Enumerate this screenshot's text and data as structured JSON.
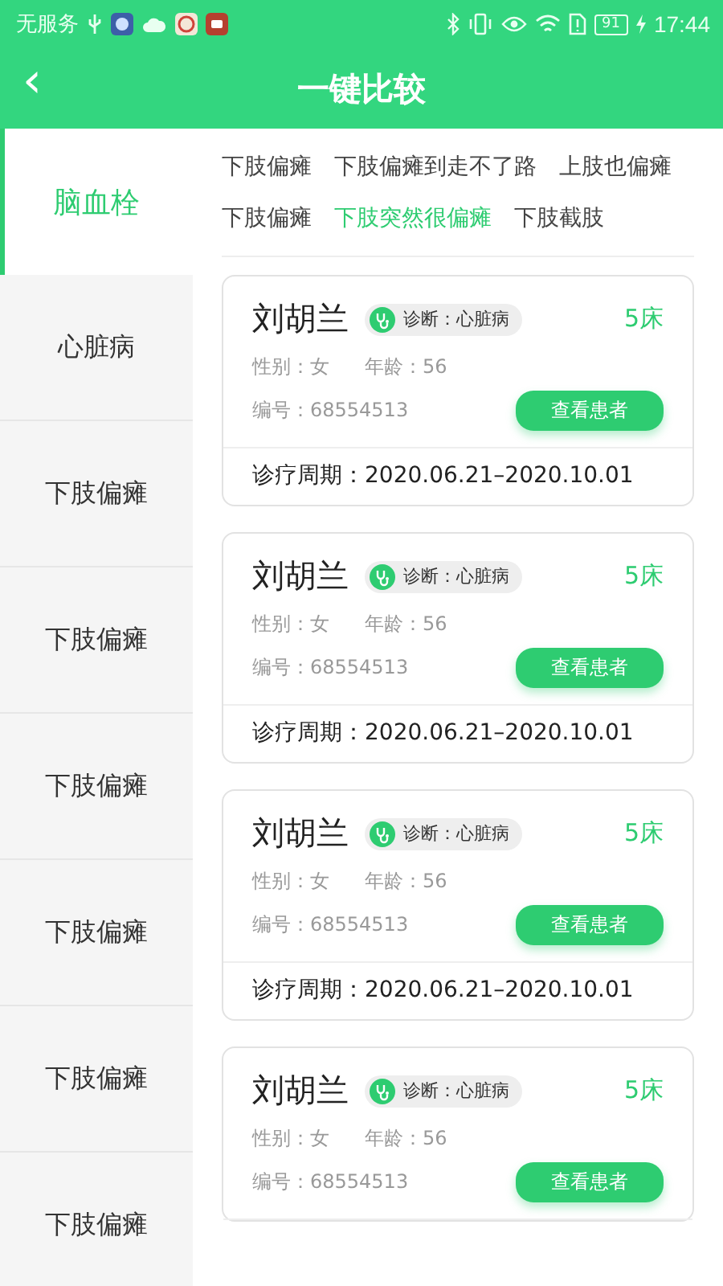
{
  "status_bar": {
    "carrier": "无服务",
    "battery": "91",
    "time": "17:44"
  },
  "header": {
    "back": "‹",
    "title": "一键比较"
  },
  "sidebar": {
    "items": [
      {
        "label": "脑血栓",
        "selected": true
      },
      {
        "label": "心脏病",
        "selected": false
      },
      {
        "label": "下肢偏瘫",
        "selected": false
      },
      {
        "label": "下肢偏瘫",
        "selected": false
      },
      {
        "label": "下肢偏瘫",
        "selected": false
      },
      {
        "label": "下肢偏瘫",
        "selected": false
      },
      {
        "label": "下肢偏瘫",
        "selected": false
      },
      {
        "label": "下肢偏瘫",
        "selected": false
      }
    ]
  },
  "tags": [
    {
      "label": "下肢偏瘫",
      "selected": false
    },
    {
      "label": "下肢偏瘫到走不了路",
      "selected": false
    },
    {
      "label": "上肢也偏瘫",
      "selected": false
    },
    {
      "label": "下肢偏瘫",
      "selected": false
    },
    {
      "label": "下肢突然很偏瘫",
      "selected": true
    },
    {
      "label": "下肢截肢",
      "selected": false
    }
  ],
  "patients": [
    {
      "name": "刘胡兰",
      "diagnosis": "诊断：心脏病",
      "bed": "5床",
      "gender": "性别：女",
      "age": "年龄：56",
      "number": "编号：68554513",
      "button": "查看患者",
      "period": "诊疗周期：2020.06.21–2020.10.01"
    },
    {
      "name": "刘胡兰",
      "diagnosis": "诊断：心脏病",
      "bed": "5床",
      "gender": "性别：女",
      "age": "年龄：56",
      "number": "编号：68554513",
      "button": "查看患者",
      "period": "诊疗周期：2020.06.21–2020.10.01"
    },
    {
      "name": "刘胡兰",
      "diagnosis": "诊断：心脏病",
      "bed": "5床",
      "gender": "性别：女",
      "age": "年龄：56",
      "number": "编号：68554513",
      "button": "查看患者",
      "period": "诊疗周期：2020.06.21–2020.10.01"
    },
    {
      "name": "刘胡兰",
      "diagnosis": "诊断：心脏病",
      "bed": "5床",
      "gender": "性别：女",
      "age": "年龄：56",
      "number": "编号：68554513",
      "button": "查看患者"
    }
  ]
}
